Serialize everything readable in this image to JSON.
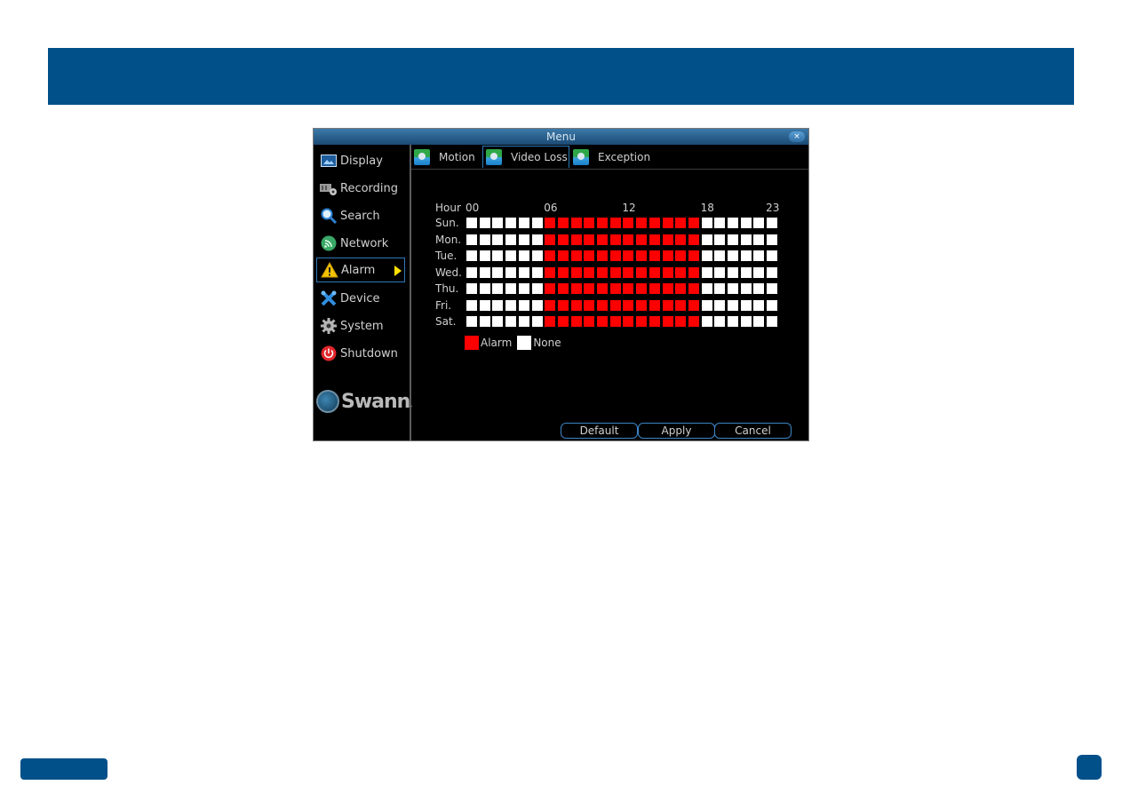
{
  "window": {
    "title": "Menu",
    "close_icon": "×"
  },
  "sidebar": {
    "items": [
      {
        "label": "Display",
        "icon": "display-icon"
      },
      {
        "label": "Recording",
        "icon": "recording-icon"
      },
      {
        "label": "Search",
        "icon": "search-icon"
      },
      {
        "label": "Network",
        "icon": "network-icon"
      },
      {
        "label": "Alarm",
        "icon": "alarm-icon",
        "active": true
      },
      {
        "label": "Device",
        "icon": "device-icon"
      },
      {
        "label": "System",
        "icon": "system-icon"
      },
      {
        "label": "Shutdown",
        "icon": "shutdown-icon"
      }
    ],
    "logo_text": "Swann",
    "logo_mark": "."
  },
  "tabs": [
    {
      "label": "Motion"
    },
    {
      "label": "Video Loss",
      "active": true
    },
    {
      "label": "Exception"
    }
  ],
  "schedule": {
    "hour_title": "Hour",
    "hour_ticks": [
      {
        "label": "00",
        "hour": 0
      },
      {
        "label": "06",
        "hour": 6
      },
      {
        "label": "12",
        "hour": 12
      },
      {
        "label": "18",
        "hour": 18
      },
      {
        "label": "23",
        "hour": 23
      }
    ],
    "days": [
      "Sun.",
      "Mon.",
      "Tue.",
      "Wed.",
      "Thu.",
      "Fri.",
      "Sat."
    ],
    "alarm_hours_start": 6,
    "alarm_hours_end": 17,
    "hours_count": 24
  },
  "legend": {
    "alarm_label": "Alarm",
    "none_label": "None"
  },
  "colors": {
    "alarm": "#ff0000",
    "none": "#ffffff",
    "accent": "#01508a"
  },
  "buttons": {
    "default_label": "Default",
    "apply_label": "Apply",
    "cancel_label": "Cancel"
  }
}
